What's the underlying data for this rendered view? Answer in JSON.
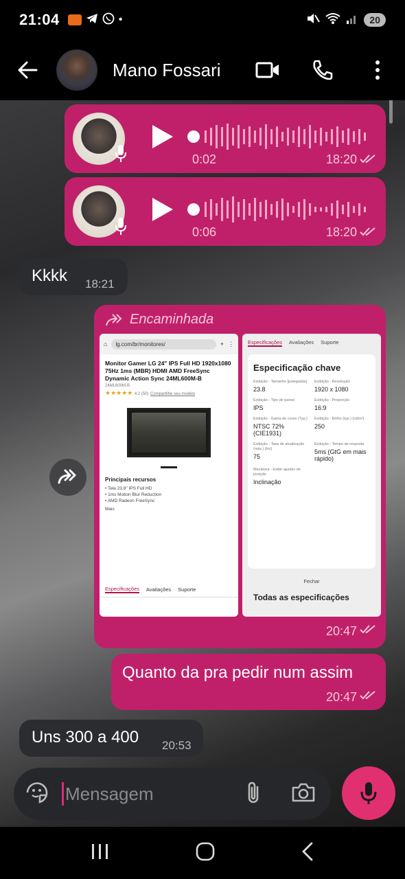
{
  "status_bar": {
    "time": "21:04",
    "battery": "20"
  },
  "header": {
    "contact_name": "Mano Fossari"
  },
  "messages": {
    "voice1": {
      "duration": "0:02",
      "time": "18:20"
    },
    "voice2": {
      "duration": "0:06",
      "time": "18:20"
    },
    "kkkk": {
      "text": "Kkkk",
      "time": "18:21"
    },
    "forwarded": {
      "label": "Encaminhada",
      "time": "20:47",
      "left_screenshot": {
        "url": "lg.com/br/monitores/",
        "product_title": "Monitor Gamer LG 24\" IPS Full HD 1920x1080 75Hz 1ms (MBR) HDMI AMD FreeSync Dynamic Action Sync 24ML600M-B",
        "sku": "24ML600M-B",
        "rating": "4.2 (50)",
        "share": "Compartilhe seu modelo",
        "section": "Principais recursos",
        "features": [
          "• Tela 23.8\" IPS Full HD",
          "• 1ms Motion Blur Reduction",
          "• AMD Radeon FreeSync"
        ],
        "more": "Mais",
        "tabs": [
          "Especificações",
          "Avaliações",
          "Suporte"
        ]
      },
      "right_screenshot": {
        "tabs": [
          "Especificações",
          "Avaliações",
          "Suporte"
        ],
        "title": "Especificação chave",
        "specs": [
          {
            "k": "Exibição - Tamanho [polegadas]",
            "v": "23.8"
          },
          {
            "k": "Exibição - Resolução",
            "v": "1920 x 1080"
          },
          {
            "k": "Exibição - Tipo de painel",
            "v": "IPS"
          },
          {
            "k": "Exibição - Proporção",
            "v": "16:9"
          },
          {
            "k": "Exibição - Gama de cores (Typ.)",
            "v": "NTSC 72% (CIE1931)"
          },
          {
            "k": "Exibição - Brilho (typ.) [cd/m²]",
            "v": "250"
          },
          {
            "k": "Exibição - Taxa de atualização (máx.) [Hz]",
            "v": "75"
          },
          {
            "k": "Exibição - Tempo de resposta",
            "v": "5ms (GtG em mais rápido)"
          },
          {
            "k": "Mecânica - Exibir ajustes de posição",
            "v": "Inclinação"
          }
        ],
        "close": "Fechar",
        "all_specs": "Todas as especificações"
      }
    },
    "quanto": {
      "text": "Quanto da pra pedir num assim",
      "time": "20:47"
    },
    "uns": {
      "text": "Uns 300 a 400",
      "time": "20:53"
    }
  },
  "composer": {
    "placeholder": "Mensagem"
  },
  "colors": {
    "outgoing_bubble": "#c0206a",
    "incoming_bubble": "#2b2c30",
    "accent": "#e0306f"
  }
}
